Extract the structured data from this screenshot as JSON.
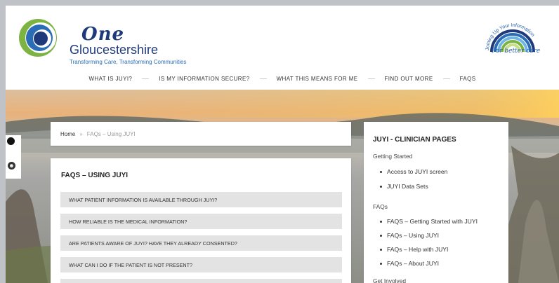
{
  "header": {
    "logo": {
      "line1": "One",
      "line2": "Gloucestershire",
      "tagline": "Transforming Care, Transforming Communities"
    },
    "juyi_logo": {
      "arc_text": "Joining Up Your Information",
      "tagline": "For better care"
    }
  },
  "nav": {
    "items": [
      {
        "label": "WHAT IS JUYI?"
      },
      {
        "label": "IS MY INFORMATION SECURE?"
      },
      {
        "label": "WHAT THIS MEANS FOR ME"
      },
      {
        "label": "FIND OUT MORE"
      },
      {
        "label": "FAQS"
      }
    ]
  },
  "breadcrumb": {
    "home": "Home",
    "separator": "»",
    "current": "FAQs – Using JUYI"
  },
  "main": {
    "title": "FAQS – USING JUYI",
    "faqs": [
      "WHAT PATIENT INFORMATION IS AVAILABLE THROUGH JUYI?",
      "HOW RELIABLE IS THE MEDICAL INFORMATION?",
      "ARE PATIENTS AWARE OF JUYI? HAVE THEY ALREADY CONSENTED?",
      "WHAT CAN I DO IF THE PATIENT IS NOT PRESENT?",
      ""
    ]
  },
  "sidebar": {
    "title": "JUYI - CLINICIAN PAGES",
    "sections": [
      {
        "heading": "Getting Started",
        "links": [
          "Access to JUYI screen",
          "JUYI Data Sets"
        ]
      },
      {
        "heading": "FAQs",
        "links": [
          "FAQS – Getting Started with JUYI",
          "FAQs – Using JUYI",
          "FAQs – Help with JUYI",
          "FAQs – About JUYI"
        ]
      },
      {
        "heading": "Get Involved",
        "links": []
      }
    ]
  },
  "colors": {
    "brand_blue": "#1e3a7a",
    "brand_green": "#7cb342",
    "accent_blue": "#2a6cb6"
  }
}
